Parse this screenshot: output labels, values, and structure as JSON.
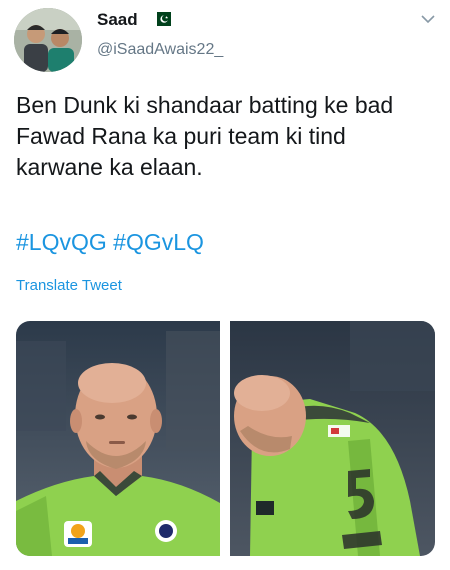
{
  "tweet": {
    "user": {
      "display_name": "Saad",
      "handle": "@iSaadAwais22_",
      "flag_icon": "pakistan-flag-icon"
    },
    "text": "Ben Dunk ki shandaar batting ke bad Fawad Rana ka puri team ki tind karwane ka elaan.",
    "hashtags": [
      "#LQvQG",
      "#QGvLQ"
    ],
    "translate_label": "Translate Tweet",
    "menu_icon": "chevron-down-icon"
  },
  "colors": {
    "link": "#1b95e0",
    "text": "#14171a",
    "secondary": "#657786",
    "jersey": "#8fd14f"
  }
}
